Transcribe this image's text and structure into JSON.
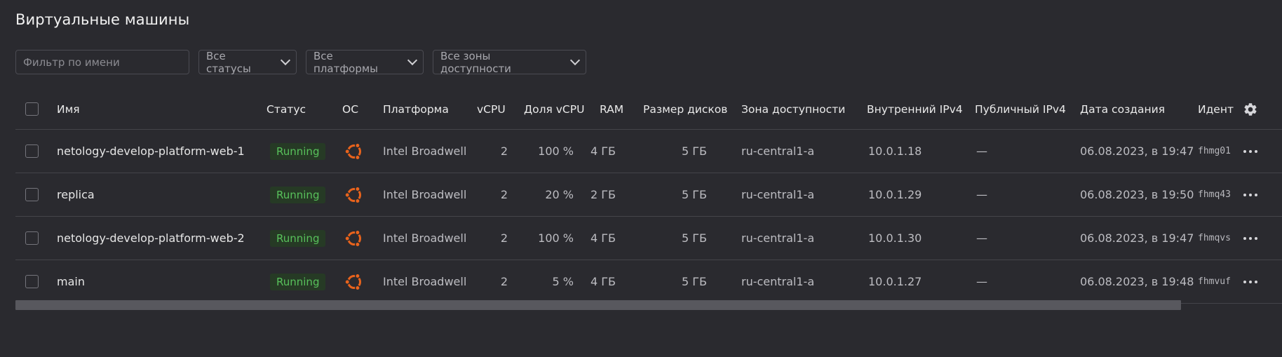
{
  "page": {
    "title": "Виртуальные машины"
  },
  "filters": {
    "name_placeholder": "Фильтр по имени",
    "status": "Все статусы",
    "platform": "Все платформы",
    "zone": "Все зоны доступности"
  },
  "table": {
    "columns": {
      "name": "Имя",
      "status": "Статус",
      "os": "ОС",
      "platform": "Платформа",
      "vcpu": "vCPU",
      "vcpu_share": "Доля vCPU",
      "ram": "RAM",
      "disk": "Размер дисков",
      "zone": "Зона доступности",
      "ip_internal": "Внутренний IPv4",
      "ip_public": "Публичный IPv4",
      "created": "Дата создания",
      "id": "Идент"
    },
    "rows": [
      {
        "name": "netology-develop-platform-web-1",
        "status": "Running",
        "os": "ubuntu",
        "platform": "Intel Broadwell",
        "vcpu": "2",
        "vcpu_share": "100 %",
        "ram": "4 ГБ",
        "disk": "5 ГБ",
        "zone": "ru-central1-a",
        "ip_internal": "10.0.1.18",
        "ip_public": "—",
        "created": "06.08.2023, в 19:47",
        "id": "fhmg01"
      },
      {
        "name": "replica",
        "status": "Running",
        "os": "ubuntu",
        "platform": "Intel Broadwell",
        "vcpu": "2",
        "vcpu_share": "20 %",
        "ram": "2 ГБ",
        "disk": "5 ГБ",
        "zone": "ru-central1-a",
        "ip_internal": "10.0.1.29",
        "ip_public": "—",
        "created": "06.08.2023, в 19:50",
        "id": "fhmq43"
      },
      {
        "name": "netology-develop-platform-web-2",
        "status": "Running",
        "os": "ubuntu",
        "platform": "Intel Broadwell",
        "vcpu": "2",
        "vcpu_share": "100 %",
        "ram": "4 ГБ",
        "disk": "5 ГБ",
        "zone": "ru-central1-a",
        "ip_internal": "10.0.1.30",
        "ip_public": "—",
        "created": "06.08.2023, в 19:47",
        "id": "fhmqvs"
      },
      {
        "name": "main",
        "status": "Running",
        "os": "ubuntu",
        "platform": "Intel Broadwell",
        "vcpu": "2",
        "vcpu_share": "5 %",
        "ram": "4 ГБ",
        "disk": "5 ГБ",
        "zone": "ru-central1-a",
        "ip_internal": "10.0.1.27",
        "ip_public": "—",
        "created": "06.08.2023, в 19:48",
        "id": "fhmvuf"
      }
    ]
  },
  "colors": {
    "background": "#2a2a2f",
    "running_text": "#58c15b",
    "running_bg": "#263a25",
    "ubuntu_orange": "#e9631c"
  },
  "icons": {
    "os": "ubuntu-icon",
    "settings": "gear-icon",
    "row_menu": "more-icon",
    "dropdown": "chevron-down-icon"
  }
}
